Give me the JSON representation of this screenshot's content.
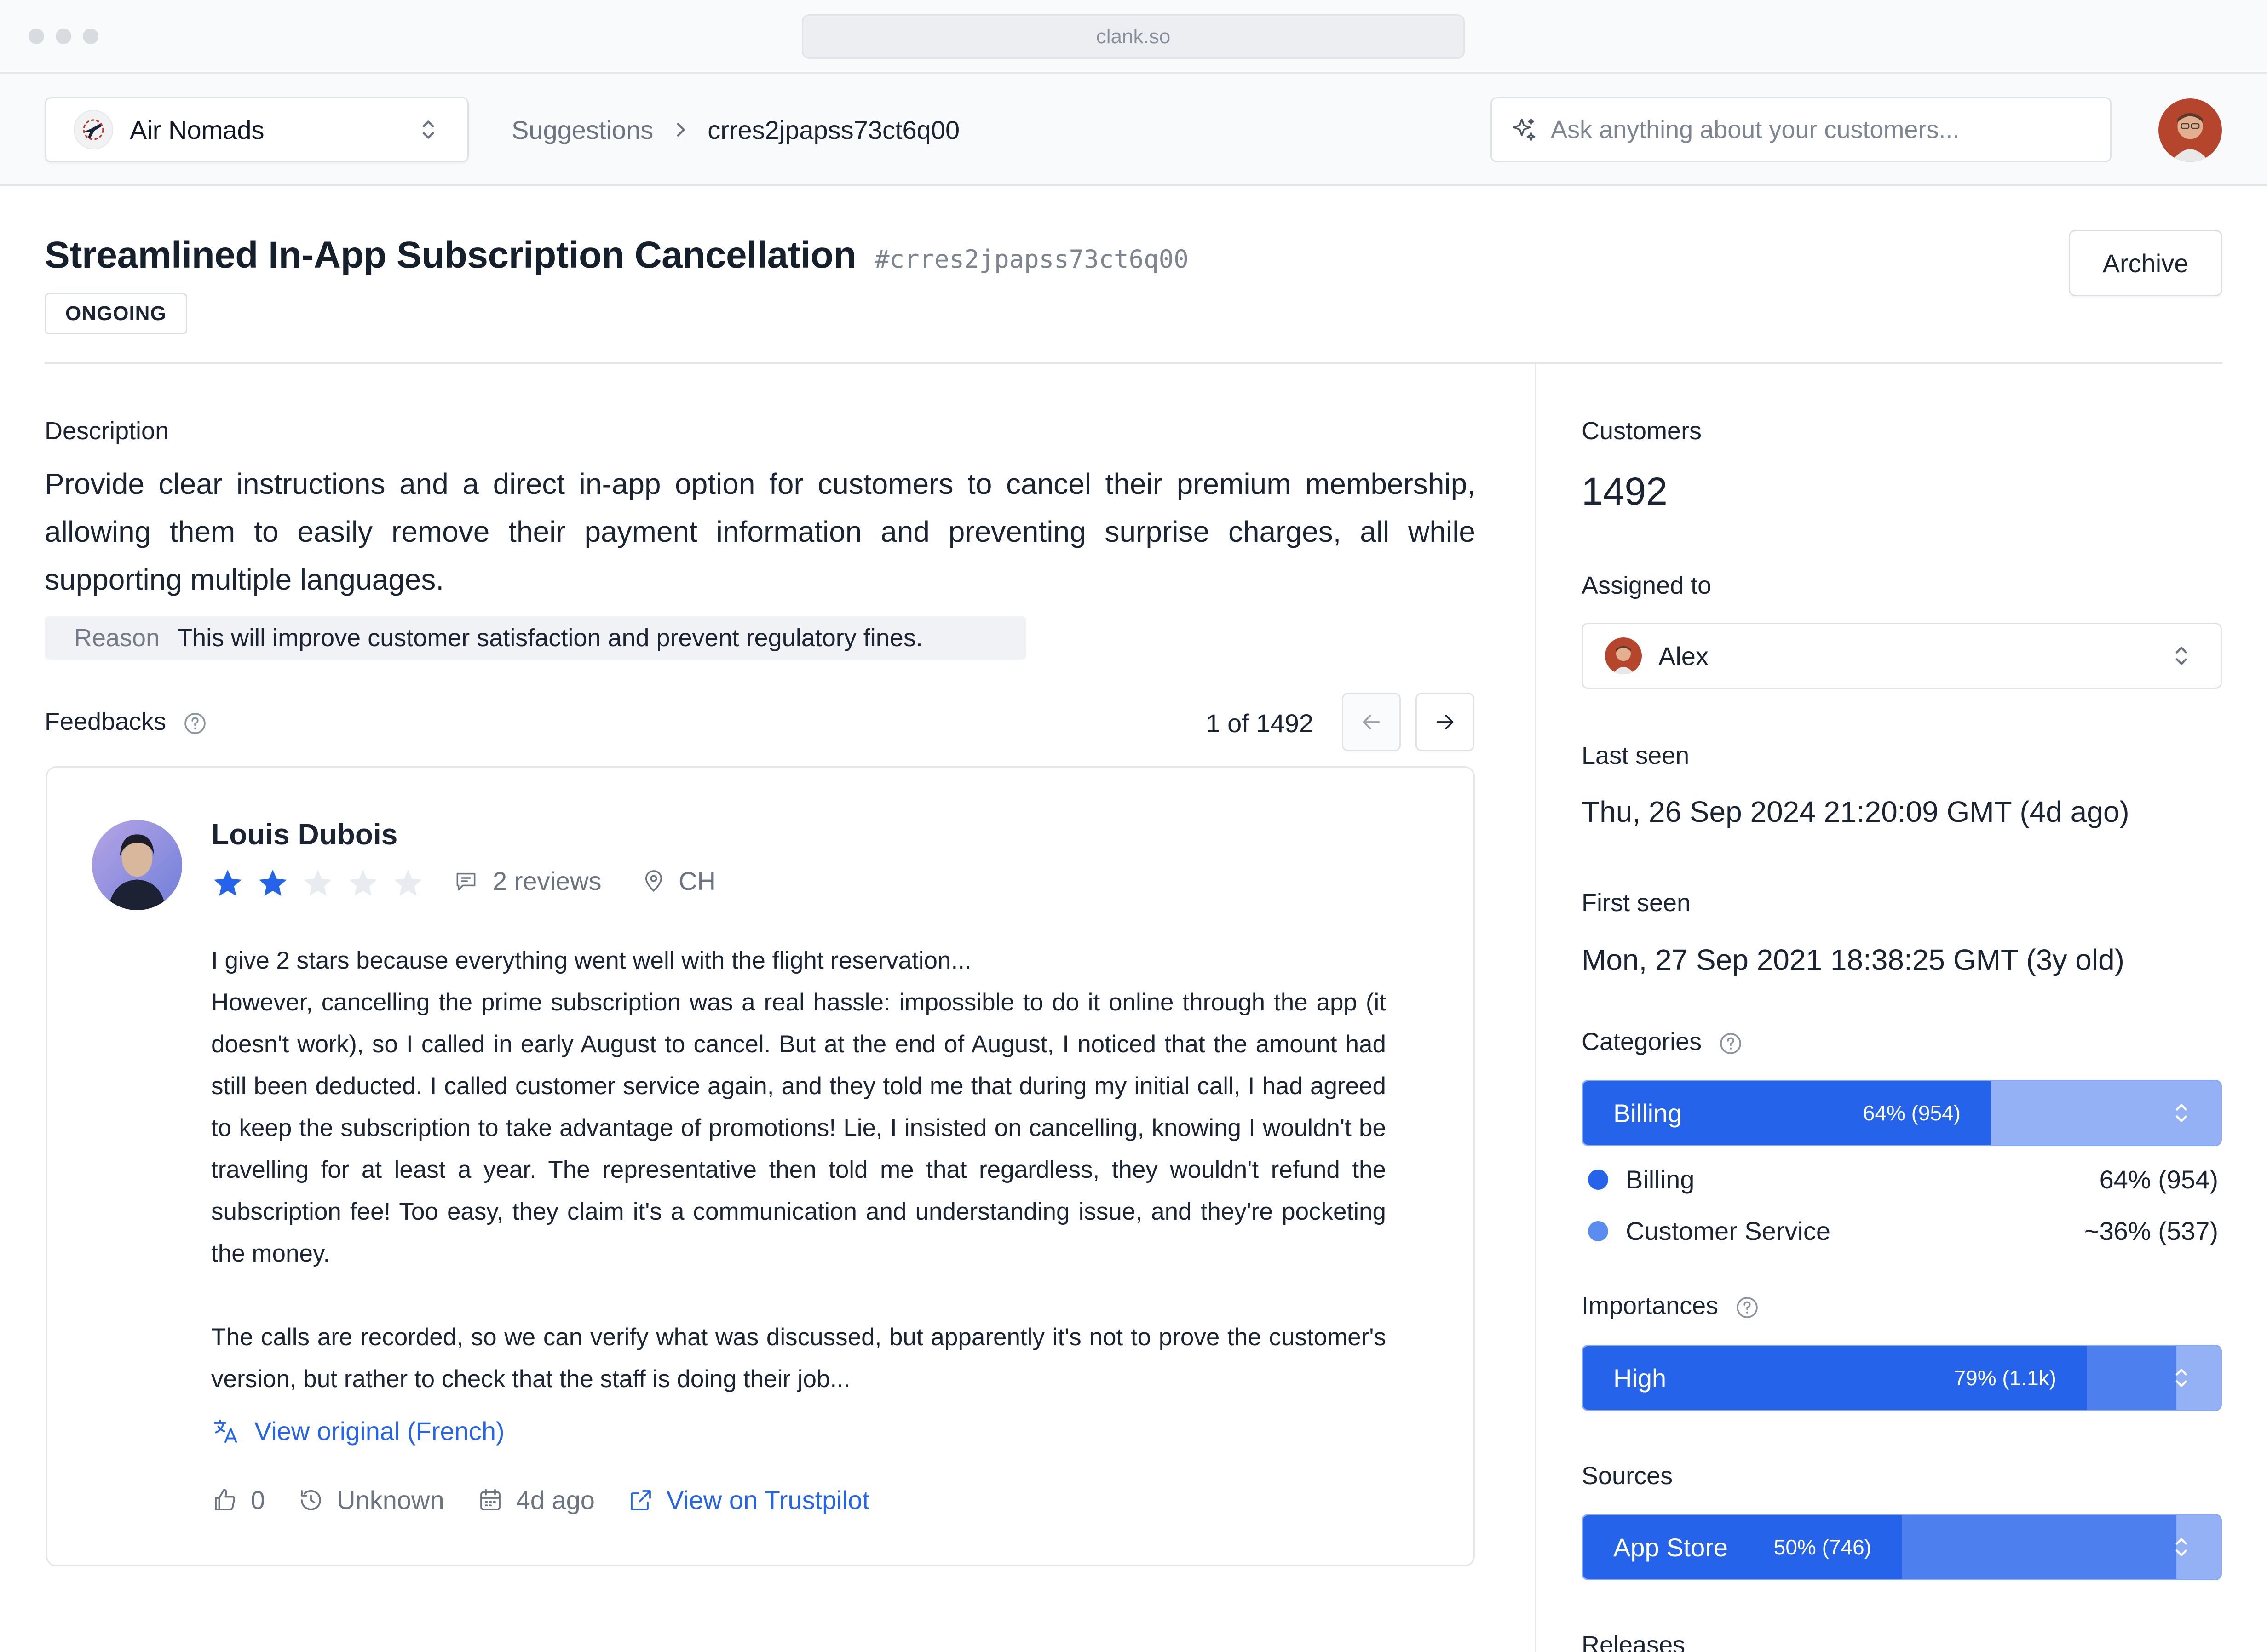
{
  "browser": {
    "url": "clank.so"
  },
  "header": {
    "org_name": "Air Nomads",
    "breadcrumb": {
      "parent": "Suggestions",
      "current": "crres2jpapss73ct6q00"
    },
    "ask_placeholder": "Ask anything about your customers..."
  },
  "suggestion": {
    "title": "Streamlined In-App Subscription Cancellation",
    "hash": "#crres2jpapss73ct6q00",
    "status": "ONGOING",
    "archive_label": "Archive",
    "description_label": "Description",
    "description": "Provide clear instructions and a direct in-app option for customers to cancel their premium membership, allowing them to easily remove their payment information and preventing surprise charges, all while supporting multiple languages.",
    "reason_label": "Reason",
    "reason": "This will improve customer satisfaction and prevent regulatory fines."
  },
  "feedbacks": {
    "label": "Feedbacks",
    "pager": "1 of 1492",
    "item": {
      "name": "Louis Dubois",
      "rating": 2,
      "rating_max": 5,
      "reviews": "2 reviews",
      "location": "CH",
      "body": [
        "I give 2 stars because everything went well with the flight reservation...",
        "However, cancelling the prime subscription was a real hassle: impossible to do it online through the app (it doesn't work), so I called in early August to cancel. But at the end of August, I noticed that the amount had still been deducted. I called customer service again, and they told me that during my initial call, I had agreed to keep the subscription to take advantage of promotions! Lie, I insisted on cancelling, knowing I wouldn't be travelling for at least a year. The representative then told me that regardless, they wouldn't refund the subscription fee! Too easy, they claim it's a communication and understanding issue, and they're pocketing the money.",
        "The calls are recorded, so we can verify what was discussed, but apparently it's not to prove the customer's version, but rather to check that the staff is doing their job..."
      ],
      "view_original": "View original (French)",
      "likes": "0",
      "history": "Unknown",
      "date": "4d ago",
      "source_link": "View on Trustpilot"
    }
  },
  "sidebar": {
    "customers_label": "Customers",
    "customers_value": "1492",
    "assigned_label": "Assigned to",
    "assigned_value": "Alex",
    "last_seen_label": "Last seen",
    "last_seen_value": "Thu, 26 Sep 2024 21:20:09 GMT (4d ago)",
    "first_seen_label": "First seen",
    "first_seen_value": "Mon, 27 Sep 2021 18:38:25 GMT (3y old)",
    "categories_label": "Categories",
    "categories_bar": {
      "label": "Billing",
      "pct_text": "64% (954)",
      "fraction": 0.64
    },
    "categories_legend": [
      {
        "name": "Billing",
        "value": "64% (954)",
        "color": "#2563eb"
      },
      {
        "name": "Customer Service",
        "value": "~36% (537)",
        "color": "#5b8cef"
      }
    ],
    "importances_label": "Importances",
    "importances_bar": {
      "label": "High",
      "pct_text": "79% (1.1k)",
      "fraction": 0.79
    },
    "sources_label": "Sources",
    "sources_bar": {
      "label": "App Store",
      "pct_text": "50% (746)",
      "fraction": 0.5
    },
    "releases_label": "Releases"
  },
  "colors": {
    "accent": "#2563eb",
    "accent_light": "#93b1f4",
    "star_off": "#e8ebef"
  }
}
